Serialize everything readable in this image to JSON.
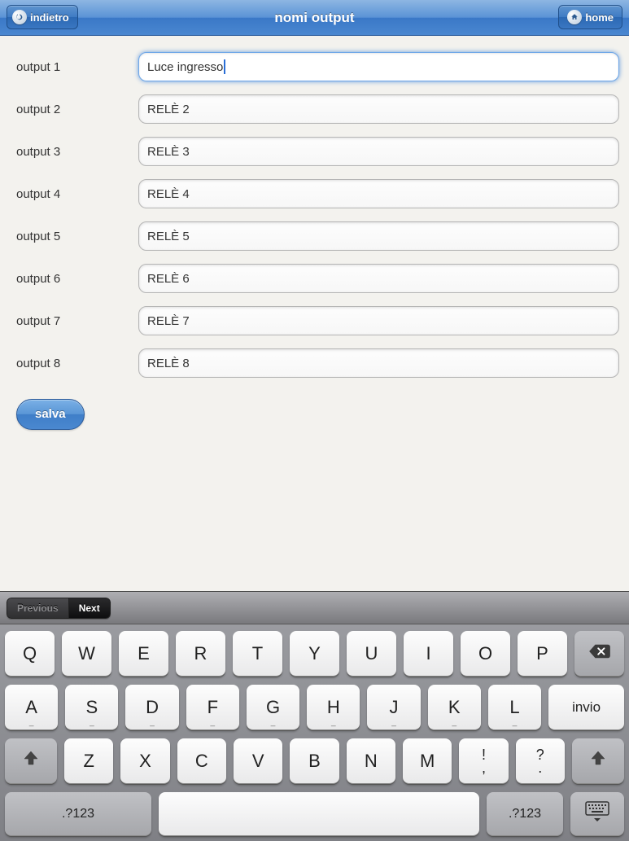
{
  "navbar": {
    "back_label": "indietro",
    "title": "nomi output",
    "home_label": "home"
  },
  "form": {
    "rows": [
      {
        "label": "output 1",
        "value": "Luce ingresso",
        "focused": true
      },
      {
        "label": "output 2",
        "value": "RELÈ 2",
        "focused": false
      },
      {
        "label": "output 3",
        "value": "RELÈ 3",
        "focused": false
      },
      {
        "label": "output 4",
        "value": "RELÈ 4",
        "focused": false
      },
      {
        "label": "output 5",
        "value": "RELÈ 5",
        "focused": false
      },
      {
        "label": "output 6",
        "value": "RELÈ 6",
        "focused": false
      },
      {
        "label": "output 7",
        "value": "RELÈ 7",
        "focused": false
      },
      {
        "label": "output 8",
        "value": "RELÈ 8",
        "focused": false
      }
    ],
    "save_label": "salva"
  },
  "form_assist": {
    "previous": "Previous",
    "next": "Next"
  },
  "keyboard": {
    "row1": [
      "Q",
      "W",
      "E",
      "R",
      "T",
      "Y",
      "U",
      "I",
      "O",
      "P"
    ],
    "row2": [
      "A",
      "S",
      "D",
      "F",
      "G",
      "H",
      "J",
      "K",
      "L"
    ],
    "row3": [
      "Z",
      "X",
      "C",
      "V",
      "B",
      "N",
      "M"
    ],
    "enter": "invio",
    "punct1_top": "!",
    "punct1_bot": ",",
    "punct2_top": "?",
    "punct2_bot": ".",
    "numkey": ".?123"
  }
}
